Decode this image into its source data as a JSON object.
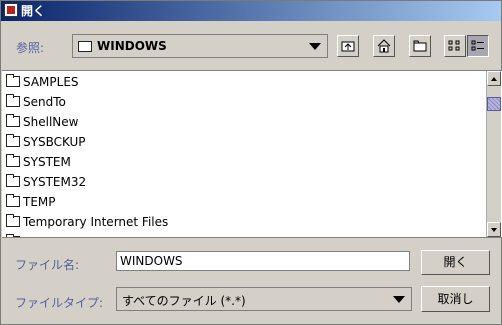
{
  "window": {
    "title": "開く"
  },
  "look_in": {
    "label": "参照:",
    "value": "WINDOWS"
  },
  "toolbar": {
    "buttons": [
      {
        "name": "up-one-level",
        "icon": "up-folder-icon"
      },
      {
        "name": "home",
        "icon": "home-icon"
      },
      {
        "name": "new-folder",
        "icon": "new-folder-icon"
      },
      {
        "name": "list-view",
        "icon": "list-view-icon"
      },
      {
        "name": "details-view",
        "icon": "details-view-icon",
        "pressed": true
      }
    ]
  },
  "files": [
    {
      "name": "SAMPLES",
      "icon": "folder-icon"
    },
    {
      "name": "SendTo",
      "icon": "folder-icon"
    },
    {
      "name": "ShellNew",
      "icon": "folder-icon"
    },
    {
      "name": "SYSBCKUP",
      "icon": "folder-icon"
    },
    {
      "name": "SYSTEM",
      "icon": "folder-icon"
    },
    {
      "name": "SYSTEM32",
      "icon": "folder-icon"
    },
    {
      "name": "TEMP",
      "icon": "folder-icon"
    },
    {
      "name": "Temporary Internet Files",
      "icon": "folder-icon"
    }
  ],
  "filename": {
    "label": "ファイル名:",
    "value": "WINDOWS"
  },
  "filetype": {
    "label": "ファイルタイプ:",
    "value": "すべてのファイル (*.*)"
  },
  "buttons": {
    "open": "開く",
    "cancel": "取消し"
  },
  "colors": {
    "label": "#565fa0",
    "title_start": "#0a246a",
    "title_end": "#a6caf0",
    "face": "#d4d0c8"
  }
}
